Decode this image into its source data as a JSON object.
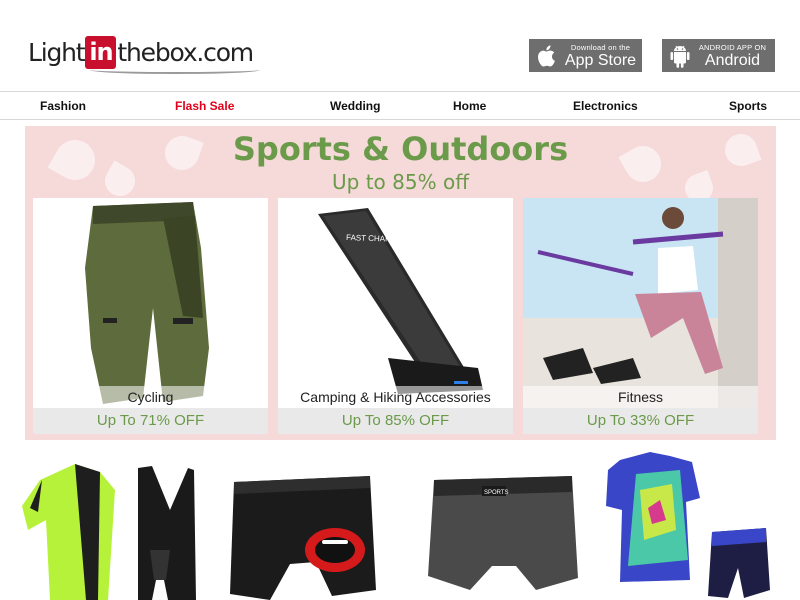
{
  "header": {
    "logo": {
      "pre": "Light",
      "box": "in",
      "post": "thebox.com"
    },
    "app_store": {
      "small": "Download on the",
      "big": "App Store",
      "icon": "apple-icon"
    },
    "android": {
      "small": "ANDROID APP ON",
      "big": "Android",
      "icon": "android-icon"
    }
  },
  "nav": {
    "items": [
      "Fashion",
      "Flash Sale",
      "Wedding",
      "Home",
      "Electronics",
      "Sports"
    ],
    "highlight_color": "#e0001a"
  },
  "banner": {
    "title": "Sports & Outdoors",
    "subtitle": "Up to 85% off",
    "accent_color": "#6a9a4a",
    "background_color": "#f6dada",
    "cards": [
      {
        "label": "Cycling",
        "discount": "Up To 71% OFF",
        "image": "cycling-shorts-image"
      },
      {
        "label": "Camping & Hiking Accessories",
        "discount": "Up To 85% OFF",
        "image": "wireless-charger-image"
      },
      {
        "label": "Fitness",
        "discount": "Up To 33% OFF",
        "image": "fitness-bar-image"
      }
    ]
  },
  "products": [
    {
      "image": "cycling-jersey-set-image"
    },
    {
      "image": "padded-underwear-image"
    },
    {
      "image": "cycling-shorts-brief-image"
    },
    {
      "image": "printed-jersey-set-image"
    }
  ]
}
